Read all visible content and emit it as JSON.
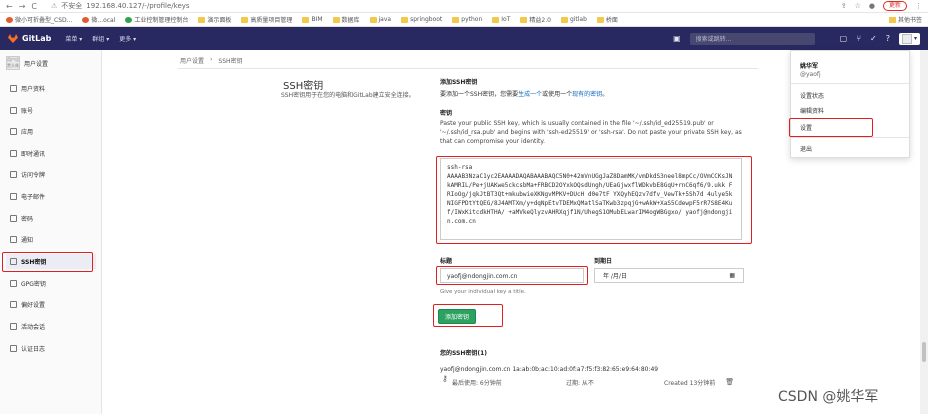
{
  "browser": {
    "nav_back": "←",
    "nav_forward": "→",
    "nav_reload": "C",
    "security": "不安全",
    "url": "192.168.40.127/-/profile/keys",
    "update_label": "更新"
  },
  "bookmarks": {
    "items": [
      {
        "label": "微小可折叠型_CSD..."
      },
      {
        "label": "微...ocal"
      },
      {
        "label": "工业控制管理控制台"
      },
      {
        "label": "演示面板"
      },
      {
        "label": "高质量项目管理"
      },
      {
        "label": "BIM"
      },
      {
        "label": "数据库"
      },
      {
        "label": "java"
      },
      {
        "label": "springboot"
      },
      {
        "label": "python"
      },
      {
        "label": "IoT"
      },
      {
        "label": "精益2.0"
      },
      {
        "label": "gitlab"
      },
      {
        "label": "桥面"
      }
    ],
    "other": "其他书签"
  },
  "gitlab": {
    "logo": "GitLab",
    "menu": [
      "菜单 ▾",
      "群组 ▾",
      "更多 ▾"
    ],
    "search_placeholder": "搜索或跳转...",
    "icons": [
      "plus-icon",
      "issues-icon",
      "merge-request-icon",
      "todo-icon",
      "help-icon"
    ],
    "avatar_caret": "▾"
  },
  "sidebar": {
    "header": "用户设置",
    "avatar_text": "用户设置头像",
    "items": [
      {
        "label": "用户资料"
      },
      {
        "label": "账号"
      },
      {
        "label": "应用"
      },
      {
        "label": "即时通讯"
      },
      {
        "label": "访问令牌"
      },
      {
        "label": "电子邮件"
      },
      {
        "label": "密码"
      },
      {
        "label": "通知"
      },
      {
        "label": "SSH密钥"
      },
      {
        "label": "GPG密钥"
      },
      {
        "label": "偏好设置"
      },
      {
        "label": "活动会话"
      },
      {
        "label": "认证日志"
      }
    ],
    "active_index": 8
  },
  "breadcrumb": [
    "用户设置",
    "SSH密钥"
  ],
  "page": {
    "title": "SSH密钥",
    "description": "SSH密钥用于在您的电脑和GitLab建立安全连接。",
    "add_title": "添加SSH密钥",
    "add_desc_prefix": "要添加一个SSH密钥，您需要",
    "add_desc_link1": "生成一个",
    "add_desc_mid": "或使用一个",
    "add_desc_link2": "现有的密钥",
    "add_desc_suffix": "。",
    "key_label": "密钥",
    "key_help": "Paste your public SSH key, which is usually contained in the file '~/.ssh/id_ed25519.pub' or '~/.ssh/id_rsa.pub' and begins with 'ssh-ed25519' or 'ssh-rsa'. Do not paste your private SSH key, as that can compromise your identity.",
    "key_value": "ssh-rsa\nAAAAB3NzaC1yc2EAAAADAQABAAABAQC5N0+42mVnUGgJaZ8DamMK/vmDkdS3neel8mpCc/OVmCCKsJNkAMRIL/Pe+jUAKwe5ckcsbMa+FRBCD2OYxkOQsdUngh/UEaGjwxflWDkvbE8GqU+rnC6qf6/9.ukk FRIoOg/jqkJtBT3Qt+mkubwieXKNgvMPKV+DUcH d0e7tF YXQyhEQzv7dfv_VewTk+5Sh7d 4ulye5kNIGFPDtYtQEG/8J4AMTXm/y+dqNpEtvTDEMxQMatlSaTKwb3zpqjG+wAkW+XaS5CdewpF5rR7S8E4Kuf/IWxKitcdkHTHA/ +aMVkeQlyzvAHRXqjf1N/UhegS1OMubELwarIM4ogWBGgxo/ yaofj@ndongjin.com.cn",
    "title_label": "标题",
    "title_value": "yaofj@ndongjin.com.cn",
    "expires_label": "到期日",
    "expires_value": "年 /月/日",
    "title_hint": "Give your individual key a title.",
    "add_button": "添加密钥",
    "your_keys_title": "您的SSH密钥(1)",
    "key_fingerprint": "yaofj@ndongjin.com.cn  1a:ab:0b:ac:10:ad:0f:a7:f5:f3:82:65:e9:64:80:49",
    "key_last_used": "最后使用:  6分钟前",
    "key_expires": "过期:  从不",
    "key_created": "Created 13分钟前"
  },
  "user_dropdown": {
    "name": "姚华军",
    "username": "@yaofj",
    "items": [
      "设置状态",
      "编辑资料",
      "设置",
      "退出"
    ],
    "highlight_index": 2
  },
  "watermark": "CSDN @姚华军"
}
